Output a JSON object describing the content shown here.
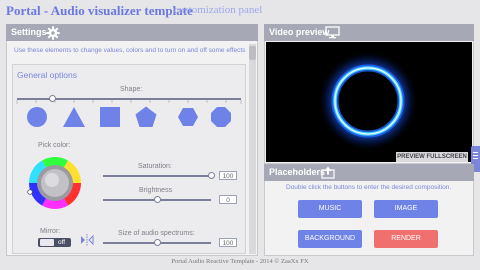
{
  "app": {
    "title": "Portal - Audio visualizer template",
    "subtitle": "customization panel"
  },
  "settings": {
    "header": "Settings",
    "help_text": "Use these elements to change values, colors and to turn on and off some effects",
    "section_title": "General options",
    "shape_label": "Shape:",
    "shape_value": 0.16,
    "shapes": [
      "circle",
      "triangle",
      "square",
      "pentagon",
      "hexagon",
      "octagon"
    ],
    "pick_color_label": "Pick color:",
    "saturation_label": "Saturation:",
    "saturation_value": "100",
    "saturation_fraction": 1.0,
    "brightness_label": "Brightness",
    "brightness_value": "0",
    "brightness_fraction": 0.5,
    "mirror_label": "Mirror:",
    "mirror_state": "off",
    "spectrum_label": "Size of audio spectrums:",
    "spectrum_value": "100",
    "spectrum_fraction": 0.5
  },
  "video": {
    "header": "Video preview",
    "preview_button": "PREVIEW FULLSCREEN"
  },
  "placeholders": {
    "header": "Placeholders",
    "help_text": "Double click the buttons to enter the desired composition.",
    "buttons": [
      "MUSIC",
      "IMAGE",
      "BACKGROUND",
      "RENDER"
    ]
  },
  "footer": "Portal Audio Reactive Template - 2014 © ZaaXx FX",
  "colors": {
    "accent": "#6a78e0",
    "button": "#6f82e8",
    "render": "#f07070",
    "header": "#a6a9b5",
    "ring": "#4fd2ff"
  }
}
